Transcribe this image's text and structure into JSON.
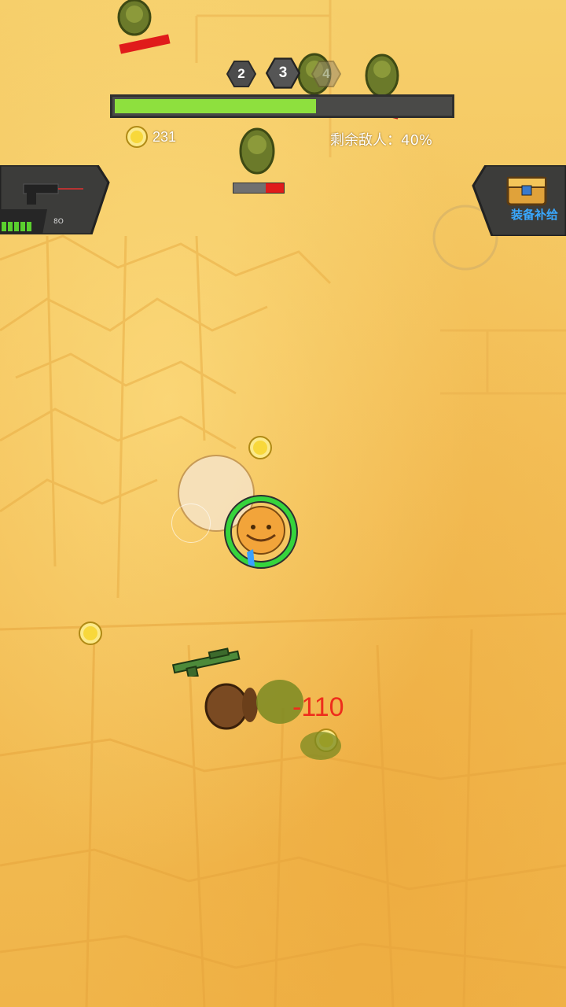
{
  "hud": {
    "waves": [
      {
        "label": "2",
        "state": "done"
      },
      {
        "label": "3",
        "state": "current"
      },
      {
        "label": "4",
        "state": "upcoming"
      }
    ],
    "wave_progress": 0.6,
    "coins": "231",
    "remaining_enemies": "剩余敌人：40%",
    "weapon_ammo": "8O",
    "supply_label": "装备补给"
  },
  "combat": {
    "damage_number": "-110"
  },
  "colors": {
    "progress_fill": "#8ee03e",
    "damage": "#ee2d1c",
    "supply_label": "#39a8ff",
    "player_ring": "#36d43c"
  },
  "icons": {
    "weapon": "pistol-icon",
    "supply": "treasure-chest-icon",
    "coin": "gold-coin-icon"
  }
}
